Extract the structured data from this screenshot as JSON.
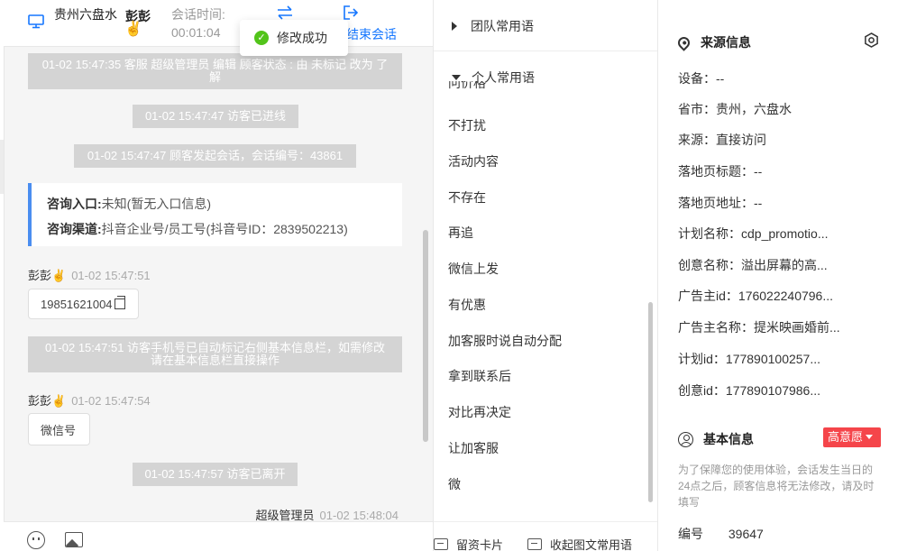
{
  "header": {
    "location": "贵州六盘水",
    "visitor_name": "彭彭",
    "visitor_emoji": "✌️",
    "session_time_label": "会话时间:",
    "session_time_value": "00:01:04",
    "end_session_label": "结束会话",
    "toast": "修改成功"
  },
  "messages": {
    "sys1": "01-02 15:47:35 客服 超级管理员 编辑 顾客状态 : 由 未标记 改为 了解",
    "sys2": "01-02 15:47:47 访客已进线",
    "sys3": "01-02 15:47:47 顾客发起会话，会话编号：43861",
    "entry_label": "咨询入口:",
    "entry_value": "未知(暂无入口信息)",
    "channel_label": "咨询渠道:",
    "channel_value": "抖音企业号/员工号(抖音号ID：2839502213)",
    "sender1_name": "彭彭✌️",
    "sender1_time": "01-02 15:47:51",
    "bubble1": "19851621004",
    "sys4": "01-02 15:47:51 访客手机号已自动标记右侧基本信息栏，如需修改请在基本信息栏直接操作",
    "sender2_name": "彭彭✌️",
    "sender2_time": "01-02 15:47:54",
    "bubble2": "微信号",
    "sys5": "01-02 15:47:57 访客已离开",
    "agent_name": "超级管理员",
    "agent_time": "01-02 15:48:04"
  },
  "phrases": {
    "team_group": "团队常用语",
    "personal_group": "个人常用语",
    "cut_item": "问价格",
    "items": [
      "不打扰",
      "活动内容",
      "不存在",
      "再追",
      "微信上发",
      "有优惠",
      "加客服时说自动分配",
      "拿到联系后",
      "对比再决定",
      "让加客服",
      "微"
    ],
    "footer_card": "留资卡片",
    "footer_collapse": "收起图文常用语"
  },
  "source_info": {
    "title": "来源信息",
    "rows": [
      {
        "k": "设备：",
        "v": "--"
      },
      {
        "k": "省市：",
        "v": "贵州，六盘水"
      },
      {
        "k": "来源：",
        "v": "直接访问"
      },
      {
        "k": "落地页标题：",
        "v": "--"
      },
      {
        "k": "落地页地址：",
        "v": "--"
      },
      {
        "k": "计划名称：",
        "v": "cdp_promotio..."
      },
      {
        "k": "创意名称：",
        "v": "溢出屏幕的高..."
      },
      {
        "k": "广告主id：",
        "v": "176022240796..."
      },
      {
        "k": "广告主名称：",
        "v": "提米映画婚前..."
      },
      {
        "k": "计划id：",
        "v": "177890100257..."
      },
      {
        "k": "创意id：",
        "v": "177890107986..."
      }
    ]
  },
  "basic_info": {
    "title": "基本信息",
    "badge": "高意愿",
    "notice": "为了保障您的使用体验，会话发生当日的24点之后，顾客信息将无法修改，请及时填写",
    "id_label": "编号",
    "id_value": "39647"
  },
  "colors": {
    "accent": "#1677ff",
    "success": "#52c41a",
    "badge": "#f5454a",
    "card_border": "#4a8df0"
  }
}
